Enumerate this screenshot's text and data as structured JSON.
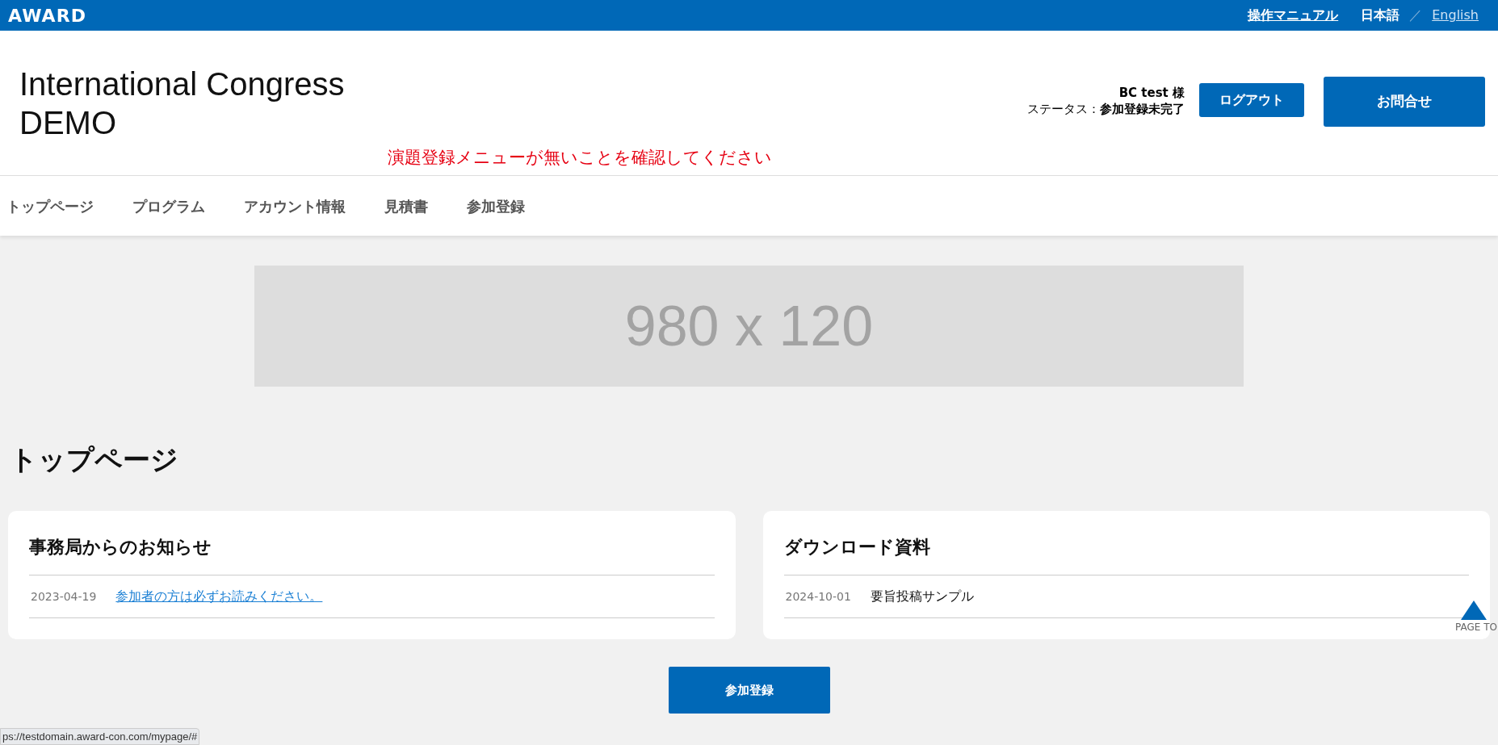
{
  "topbar": {
    "logo": "AWARD",
    "manual_link": "操作マニュアル",
    "languages": [
      {
        "label": "日本語",
        "selected": true
      },
      {
        "label": "English",
        "selected": false
      }
    ],
    "separator": "／"
  },
  "header": {
    "title_lines": [
      "International Congress",
      "DEMO"
    ],
    "notice": "演題登録メニューが無いことを確認してください",
    "user_name": "BC test 様",
    "status_label": "ステータス：",
    "status_value": "参加登録未完了",
    "logout_button": "ログアウト",
    "contact_button": "お問合せ"
  },
  "nav": {
    "items": [
      {
        "label": "トップページ"
      },
      {
        "label": "プログラム"
      },
      {
        "label": "アカウント情報"
      },
      {
        "label": "見積書"
      },
      {
        "label": "参加登録"
      }
    ]
  },
  "banner": {
    "text": "980 x 120"
  },
  "page_title": "トップページ",
  "cards": [
    {
      "title": "事務局からのお知らせ",
      "items": [
        {
          "date": "2023-04-19",
          "text": "参加者の方は必ずお読みください。",
          "kind": "link"
        }
      ]
    },
    {
      "title": "ダウンロード資料",
      "items": [
        {
          "date": "2024-10-01",
          "text": "要旨投稿サンプル",
          "kind": "plain"
        }
      ]
    }
  ],
  "register_button": "参加登録",
  "page_top": "PAGE TO",
  "status_url": "ps://testdomain.award-con.com/mypage/#"
}
